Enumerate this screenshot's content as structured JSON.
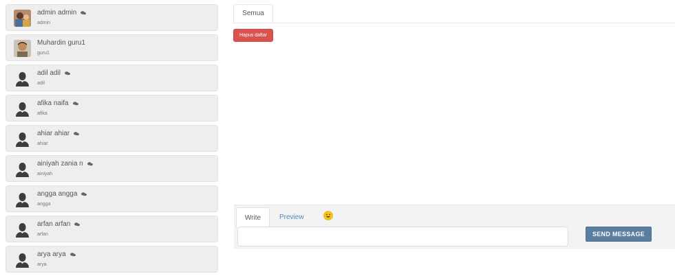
{
  "users": [
    {
      "name": "admin admin",
      "handle": "admin",
      "avatar": "photo-avatar",
      "chat_icon": true
    },
    {
      "name": "Muhardin guru1",
      "handle": "guru1",
      "avatar": "photo-avatar",
      "chat_icon": false
    },
    {
      "name": "adil adil",
      "handle": "adil",
      "avatar": "user-silhouette-icon",
      "chat_icon": true
    },
    {
      "name": "afika naifa",
      "handle": "afika",
      "avatar": "user-silhouette-icon",
      "chat_icon": true
    },
    {
      "name": "ahiar ahiar",
      "handle": "ahiar",
      "avatar": "user-silhouette-icon",
      "chat_icon": true
    },
    {
      "name": "ainiyah zania n",
      "handle": "ainiyah",
      "avatar": "user-silhouette-icon",
      "chat_icon": true
    },
    {
      "name": "angga angga",
      "handle": "angga",
      "avatar": "user-silhouette-icon",
      "chat_icon": true
    },
    {
      "name": "arfan arfan",
      "handle": "arfan",
      "avatar": "user-silhouette-icon",
      "chat_icon": true
    },
    {
      "name": "arya arya",
      "handle": "arya",
      "avatar": "user-silhouette-icon",
      "chat_icon": true
    }
  ],
  "tabs": {
    "semua": "Semua"
  },
  "actions": {
    "hapus_daftar": "Hapus daftar"
  },
  "composer": {
    "write_tab": "Write",
    "preview_tab": "Preview",
    "emoji": "smiley-emoji-icon",
    "message_value": "",
    "send_label": "SEND MESSAGE"
  },
  "colors": {
    "danger": "#d9534f",
    "send_button": "#5b7e9f",
    "link": "#4a8cc7",
    "card_bg": "#eeeeee",
    "silhouette": "#3d3d3d"
  }
}
